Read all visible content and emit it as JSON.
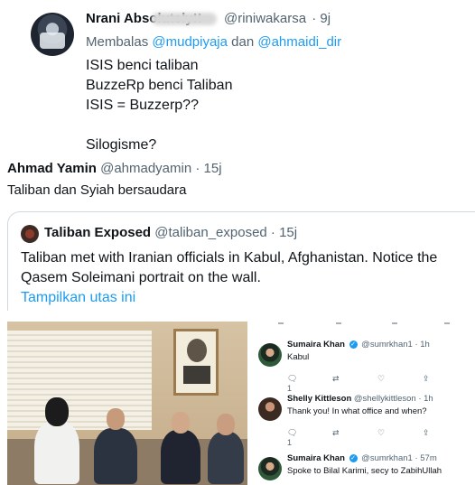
{
  "tweet1": {
    "author_name": "Nrani Absolutely!!",
    "handle": "@riniwakarsa",
    "time": "· 9j",
    "reply_prefix": "Membalas",
    "reply_to_1": "@mudpiyaja",
    "reply_and": "dan",
    "reply_to_2": "@ahmaidi_dir",
    "lines": [
      "ISIS benci taliban",
      "BuzzeRp benci Taliban",
      "ISIS = Buzzerp??",
      "",
      "Silogisme?"
    ]
  },
  "tweet2": {
    "author_name": "Ahmad Yamin",
    "handle": "@ahmadyamin",
    "time": "· 15j",
    "text": "Taliban dan Syiah bersaudara",
    "quote": {
      "author_name": "Taliban Exposed",
      "handle": "@taliban_exposed",
      "time": "· 15j",
      "text": "Taliban met with Iranian officials in Kabul, Afghanistan. Notice the Qasem Soleimani portrait on the wall.",
      "show_thread": "Tampilkan utas ini"
    },
    "thread": {
      "replies": [
        {
          "name": "Sumaira Khan",
          "handle": "@sumrkhan1",
          "time": "· 1h",
          "text": "Kabul",
          "reply_count": "1",
          "retweet_count": "",
          "like_count": ""
        },
        {
          "name": "Shelly Kittleson",
          "handle": "@shellykittleson",
          "time": "· 1h",
          "text": "Thank you! In what office and when?",
          "reply_count": "1",
          "retweet_count": "",
          "like_count": ""
        },
        {
          "name": "Sumaira Khan",
          "handle": "@sumrkhan1",
          "time": "· 57m",
          "text": "Spoke to Bilal Karimi, secy to ZabihUllah"
        }
      ]
    }
  },
  "icons": {
    "reply": "reply-icon",
    "retweet": "retweet-icon",
    "like": "heart-icon",
    "share": "share-icon",
    "more": "more-icon",
    "verified": "verified-badge-icon"
  },
  "colors": {
    "link": "#1d9bf0",
    "secondary_text": "#536471",
    "primary_text": "#0f1419",
    "border": "#cfd9de"
  }
}
